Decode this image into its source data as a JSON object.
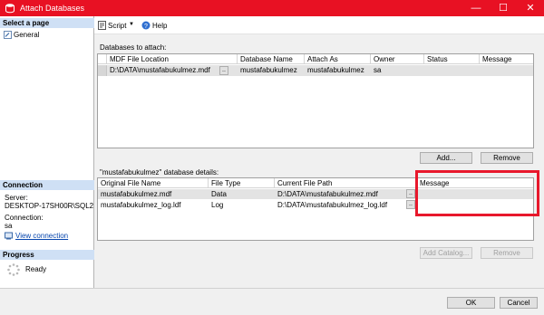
{
  "window": {
    "title": "Attach Databases",
    "minimize": "—",
    "maximize": "☐",
    "close": "✕"
  },
  "left": {
    "select_page_heading": "Select a page",
    "pages": [
      {
        "label": "General"
      }
    ],
    "connection_heading": "Connection",
    "server_label": "Server:",
    "server_value": "DESKTOP-17SH00R\\SQL2",
    "connection_label": "Connection:",
    "connection_value": "sa",
    "view_connection_link": "View connection",
    "progress_heading": "Progress",
    "progress_status": "Ready"
  },
  "toolbar": {
    "script_label": "Script",
    "help_label": "Help"
  },
  "attach": {
    "section_label": "Databases to attach:",
    "columns": [
      "MDF File Location",
      "Database Name",
      "Attach As",
      "Owner",
      "Status",
      "Message"
    ],
    "rows": [
      {
        "mdf": "D:\\DATA\\mustafabukulmez.mdf",
        "database_name": "mustafabukulmez",
        "attach_as": "mustafabukulmez",
        "owner": "sa",
        "status": "",
        "message": ""
      }
    ],
    "ellipsis": "..",
    "add_label": "Add...",
    "remove_label": "Remove"
  },
  "details": {
    "section_label": "\"mustafabukulmez\" database details:",
    "columns": [
      "Original File Name",
      "File Type",
      "Current File Path",
      "Message"
    ],
    "rows": [
      {
        "file_name": "mustafabukulmez.mdf",
        "file_type": "Data",
        "path": "D:\\DATA\\mustafabukulmez.mdf",
        "message": ""
      },
      {
        "file_name": "mustafabukulmez_log.ldf",
        "file_type": "Log",
        "path": "D:\\DATA\\mustafabukulmez_log.ldf",
        "message": ""
      }
    ],
    "add_catalog_label": "Add Catalog...",
    "remove_label": "Remove"
  },
  "footer": {
    "ok_label": "OK",
    "cancel_label": "Cancel"
  },
  "colors": {
    "titlebar": "#e81123",
    "highlight_box": "#e8182c",
    "section_header": "#cfe0f5",
    "link": "#0645ad"
  }
}
